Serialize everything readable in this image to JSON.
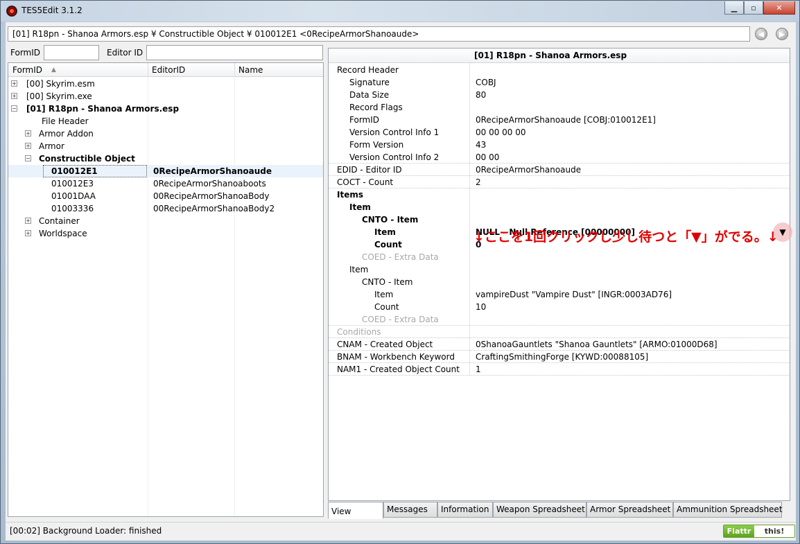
{
  "window": {
    "title": "TES5Edit 3.1.2"
  },
  "window_buttons": {
    "minimize": "▁",
    "maximize": "▫",
    "close": "✕"
  },
  "path": {
    "text": "[01] R18pn - Shanoa Armors.esp ¥ Constructible Object ¥ 010012E1 <0RecipeArmorShanoaude>"
  },
  "nav": {
    "back": "◀",
    "forward": "▶"
  },
  "filter": {
    "formid_label": "FormID",
    "editorid_label": "Editor ID",
    "formid_value": "",
    "editorid_value": ""
  },
  "tree": {
    "columns": [
      "FormID",
      "EditorID",
      "Name"
    ],
    "sort_indicator": "▲",
    "rows": [
      {
        "formid": "[00] Skyrim.esm",
        "editorid": "",
        "expander": "+",
        "bold": false
      },
      {
        "formid": "[00] Skyrim.exe",
        "editorid": "",
        "expander": "+",
        "bold": false
      },
      {
        "formid": "[01] R18pn - Shanoa Armors.esp",
        "editorid": "",
        "expander": "−",
        "bold": true
      },
      {
        "formid": "File Header",
        "editorid": "",
        "expander": "",
        "bold": false
      },
      {
        "formid": "Armor Addon",
        "editorid": "",
        "expander": "+",
        "bold": false
      },
      {
        "formid": "Armor",
        "editorid": "",
        "expander": "+",
        "bold": false
      },
      {
        "formid": "Constructible Object",
        "editorid": "",
        "expander": "−",
        "bold": true
      },
      {
        "formid": "010012E1",
        "editorid": "0RecipeArmorShanoaude",
        "expander": "",
        "bold": true
      },
      {
        "formid": "010012E3",
        "editorid": "0RecipeArmorShanoaboots",
        "expander": "",
        "bold": false
      },
      {
        "formid": "01001DAA",
        "editorid": "00RecipeArmorShanoaBody",
        "expander": "",
        "bold": false
      },
      {
        "formid": "01003336",
        "editorid": "00RecipeArmorShanoaBody2",
        "expander": "",
        "bold": false
      },
      {
        "formid": "Container",
        "editorid": "",
        "expander": "+",
        "bold": false
      },
      {
        "formid": "Worldspace",
        "editorid": "",
        "expander": "+",
        "bold": false
      }
    ]
  },
  "record": {
    "header_title": "[01] R18pn - Shanoa Armors.esp",
    "rows": [
      {
        "key": "Record Header",
        "value": "",
        "bold": false,
        "grey": false
      },
      {
        "key": "Signature",
        "value": "COBJ",
        "bold": false,
        "grey": false
      },
      {
        "key": "Data Size",
        "value": "80",
        "bold": false,
        "grey": false
      },
      {
        "key": "Record Flags",
        "value": "",
        "bold": false,
        "grey": false
      },
      {
        "key": "FormID",
        "value": "0RecipeArmorShanoaude [COBJ:010012E1]",
        "bold": false,
        "grey": false
      },
      {
        "key": "Version Control Info 1",
        "value": "00 00 00 00",
        "bold": false,
        "grey": false
      },
      {
        "key": "Form Version",
        "value": "43",
        "bold": false,
        "grey": false
      },
      {
        "key": "Version Control Info 2",
        "value": "00 00",
        "bold": false,
        "grey": false
      },
      {
        "key": "EDID - Editor ID",
        "value": "0RecipeArmorShanoaude",
        "bold": false,
        "grey": false
      },
      {
        "key": "COCT - Count",
        "value": "2",
        "bold": false,
        "grey": false
      },
      {
        "key": "Items",
        "value": "",
        "bold": true,
        "grey": false
      },
      {
        "key": "Item",
        "value": "",
        "bold": true,
        "grey": false
      },
      {
        "key": "CNTO - Item",
        "value": "",
        "bold": true,
        "grey": false
      },
      {
        "key": "Item",
        "value": "NULL - Null Reference [00000000]",
        "bold": true,
        "grey": false
      },
      {
        "key": "Count",
        "value": "0",
        "bold": true,
        "grey": false
      },
      {
        "key": "COED - Extra Data",
        "value": "",
        "bold": false,
        "grey": true
      },
      {
        "key": "Item",
        "value": "",
        "bold": false,
        "grey": false
      },
      {
        "key": "CNTO - Item",
        "value": "",
        "bold": false,
        "grey": false
      },
      {
        "key": "Item",
        "value": "vampireDust \"Vampire Dust\" [INGR:0003AD76]",
        "bold": false,
        "grey": false
      },
      {
        "key": "Count",
        "value": "10",
        "bold": false,
        "grey": false
      },
      {
        "key": "COED - Extra Data",
        "value": "",
        "bold": false,
        "grey": true
      },
      {
        "key": "Conditions",
        "value": "",
        "bold": false,
        "grey": true
      },
      {
        "key": "CNAM - Created Object",
        "value": "0ShanoaGauntlets \"Shanoa Gauntlets\" [ARMO:01000D68]",
        "bold": false,
        "grey": false
      },
      {
        "key": "BNAM - Workbench Keyword",
        "value": "CraftingSmithingForge [KYWD:00088105]",
        "bold": false,
        "grey": false
      },
      {
        "key": "NAM1 - Created Object Count",
        "value": "1",
        "bold": false,
        "grey": false
      }
    ]
  },
  "annotation": {
    "text": "↓ここを1回クリックし少し待つと「▼」がでる。↓"
  },
  "dropdown": {
    "glyph": "▼"
  },
  "tabs": [
    "View",
    "Messages",
    "Information",
    "Weapon Spreadsheet",
    "Armor Spreadsheet",
    "Ammunition Spreadsheet"
  ],
  "status": {
    "text": "[00:02] Background Loader: finished"
  },
  "flattr": {
    "left": "Flattr",
    "right": "this!"
  }
}
